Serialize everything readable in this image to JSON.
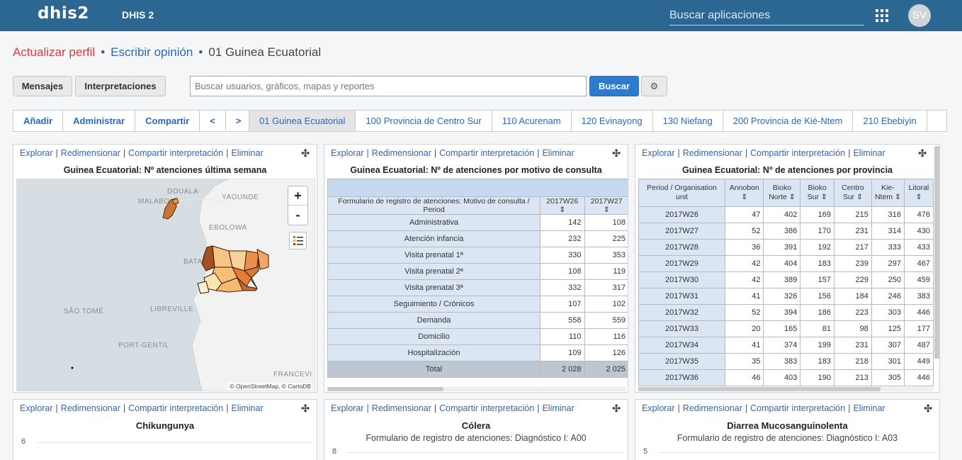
{
  "header": {
    "logo": "dhis2",
    "title": "DHIS 2",
    "search_placeholder": "Buscar aplicaciones",
    "avatar_initials": "SV"
  },
  "breadcrumb": {
    "update_profile": "Actualizar perfil",
    "write_feedback": "Escribir opinión",
    "current": "01 Guinea Ecuatorial"
  },
  "toolbar": {
    "messages": "Mensajes",
    "interpretations": "Interpretaciones",
    "search_placeholder": "Buscar usuarios, gráficos, mapas y reportes",
    "search_button": "Buscar"
  },
  "dashboard_tools": [
    "Añadir",
    "Administrar",
    "Compartir",
    "<",
    ">"
  ],
  "dashboard_tabs": [
    "01 Guinea Ecuatorial",
    "100 Provincia de Centro Sur",
    "110 Acurenam",
    "120 Evinayong",
    "130 Niefang",
    "200 Provincia de Kié-Ntem",
    "210 Ebebiyin"
  ],
  "panel_links": {
    "explore": "Explorar",
    "resize": "Redimensionar",
    "share": "Compartir interpretación",
    "delete": "Eliminar"
  },
  "map_panel": {
    "title": "Guinea Ecuatorial: Nº atenciones última semana",
    "labels": [
      "DOUALA",
      "YAOUNDE",
      "MALABO",
      "EBOLOWA",
      "BATA",
      "SÃO TOMÉ",
      "LIBREVILLE",
      "PORT-GENTIL",
      "FRANCEVI"
    ],
    "zoom_in": "+",
    "zoom_out": "-",
    "attribution": "© OpenStreetMap, © CartoDB"
  },
  "motivo_panel": {
    "title": "Guinea Ecuatorial: Nº de atenciones por motivo de consulta",
    "header_label": "Formulario de registro de atenciones: Motivo de consulta / Period",
    "columns": [
      "2017W26",
      "2017W27"
    ],
    "rows": [
      {
        "label": "Administrativa",
        "values": [
          "142",
          "108"
        ]
      },
      {
        "label": "Atención infancia",
        "values": [
          "232",
          "225"
        ]
      },
      {
        "label": "Visita prenatal 1ª",
        "values": [
          "330",
          "353"
        ]
      },
      {
        "label": "Visita prenatal 2ª",
        "values": [
          "108",
          "119"
        ]
      },
      {
        "label": "Visita prenatal 3ª",
        "values": [
          "332",
          "317"
        ]
      },
      {
        "label": "Seguimiento / Crónicos",
        "values": [
          "107",
          "102"
        ]
      },
      {
        "label": "Demanda",
        "values": [
          "558",
          "559"
        ]
      },
      {
        "label": "Domicilio",
        "values": [
          "110",
          "116"
        ]
      },
      {
        "label": "Hospitalización",
        "values": [
          "109",
          "126"
        ]
      }
    ],
    "total": {
      "label": "Total",
      "values": [
        "2 028",
        "2 025"
      ]
    }
  },
  "provincia_panel": {
    "title": "Guinea Ecuatorial: Nº de atenciones por provincia",
    "columns": [
      "Period / Organisation unit",
      "Annobon",
      "Bioko Norte",
      "Bioko Sur",
      "Centro Sur",
      "Kie-Ntem",
      "Litoral"
    ],
    "rows": [
      {
        "label": "2017W26",
        "values": [
          "47",
          "402",
          "169",
          "215",
          "316",
          "476"
        ]
      },
      {
        "label": "2017W27",
        "values": [
          "52",
          "386",
          "170",
          "231",
          "314",
          "430"
        ]
      },
      {
        "label": "2017W28",
        "values": [
          "36",
          "391",
          "192",
          "217",
          "333",
          "433"
        ]
      },
      {
        "label": "2017W29",
        "values": [
          "42",
          "404",
          "183",
          "239",
          "297",
          "467"
        ]
      },
      {
        "label": "2017W30",
        "values": [
          "42",
          "389",
          "157",
          "229",
          "250",
          "459"
        ]
      },
      {
        "label": "2017W31",
        "values": [
          "41",
          "326",
          "156",
          "184",
          "246",
          "383"
        ]
      },
      {
        "label": "2017W32",
        "values": [
          "52",
          "394",
          "186",
          "223",
          "303",
          "446"
        ]
      },
      {
        "label": "2017W33",
        "values": [
          "20",
          "165",
          "81",
          "98",
          "125",
          "177"
        ]
      },
      {
        "label": "2017W34",
        "values": [
          "41",
          "374",
          "199",
          "231",
          "307",
          "487"
        ]
      },
      {
        "label": "2017W35",
        "values": [
          "35",
          "383",
          "183",
          "218",
          "301",
          "449"
        ]
      },
      {
        "label": "2017W36",
        "values": [
          "46",
          "403",
          "190",
          "213",
          "305",
          "446"
        ]
      }
    ]
  },
  "bottom_panels": [
    {
      "title": "Chikungunya",
      "subtitle": "",
      "ytick": "6"
    },
    {
      "title": "Cólera",
      "subtitle": "Formulario de registro de atenciones: Diagnóstico I: A00",
      "ytick": "8"
    },
    {
      "title": "Diarrea Mucosanguinolenta",
      "subtitle": "Formulario de registro de atenciones: Diagnóstico I: A03",
      "ytick": "5"
    }
  ],
  "colors": {
    "header_bg": "#2c6693",
    "link": "#2f66b5",
    "accent_red": "#d23d3d",
    "primary_button": "#2c7bcf"
  }
}
